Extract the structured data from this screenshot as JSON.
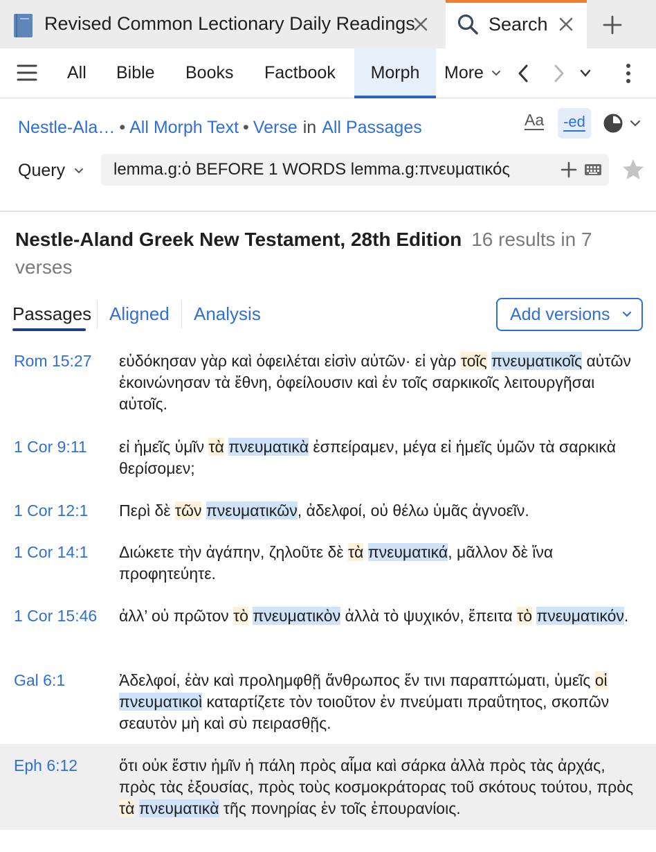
{
  "window_tabs": {
    "document_tab_title": "Revised Common Lectionary Daily Readings",
    "search_tab_title": "Search"
  },
  "toolbar": {
    "categories": [
      "All",
      "Bible",
      "Books",
      "Factbook",
      "Morph"
    ],
    "active_category": "Morph",
    "more_label": "More"
  },
  "query_area": {
    "crumbs": {
      "resource": "Nestle-Ala…",
      "scope": "All Morph Text",
      "unit": "Verse",
      "in_word": "in",
      "range": "All Passages"
    },
    "aa_label": "Aa",
    "ed_label": "-ed",
    "query_label": "Query",
    "query_text": "lemma.g:ὁ BEFORE 1 WORDS lemma.g:πνευματικός"
  },
  "results": {
    "resource_title": "Nestle-Aland Greek New Testament, 28th Edition",
    "count_text": "16 results in 7 verses",
    "tabs": [
      "Passages",
      "Aligned",
      "Analysis"
    ],
    "active_tab": "Passages",
    "add_versions_label": "Add versions",
    "items": [
      {
        "ref": "Rom 15:27",
        "segments": [
          {
            "t": "εὐδόκησαν γὰρ καὶ ὀφειλέται εἰσὶν αὐτῶν· εἰ γὰρ ",
            "h": ""
          },
          {
            "t": "τοῖς",
            "h": "y"
          },
          {
            "t": " ",
            "h": ""
          },
          {
            "t": "πνευματικοῖς",
            "h": "b"
          },
          {
            "t": " αὐτῶν ἐκοινώνησαν τὰ ἔθνη, ὀφείλουσιν καὶ ἐν τοῖς σαρκικοῖς λειτουργῆσαι αὐτοῖς.",
            "h": ""
          }
        ]
      },
      {
        "ref": "1 Cor 9:11",
        "segments": [
          {
            "t": "εἰ ἡμεῖς ὑμῖν ",
            "h": ""
          },
          {
            "t": "τὰ",
            "h": "y"
          },
          {
            "t": " ",
            "h": ""
          },
          {
            "t": "πνευματικὰ",
            "h": "b"
          },
          {
            "t": " ἐσπείραμεν, μέγα εἰ ἡμεῖς ὑμῶν τὰ σαρκικὰ θερίσομεν;",
            "h": ""
          }
        ]
      },
      {
        "ref": "1 Cor 12:1",
        "segments": [
          {
            "t": "Περὶ δὲ ",
            "h": ""
          },
          {
            "t": "τῶν",
            "h": "y"
          },
          {
            "t": " ",
            "h": ""
          },
          {
            "t": "πνευματικῶν",
            "h": "b"
          },
          {
            "t": ", ἀδελφοί, οὐ θέλω ὑμᾶς ἀγνοεῖν.",
            "h": ""
          }
        ]
      },
      {
        "ref": "1 Cor 14:1",
        "segments": [
          {
            "t": "Διώκετε τὴν ἀγάπην, ζηλοῦτε δὲ ",
            "h": ""
          },
          {
            "t": "τὰ",
            "h": "y"
          },
          {
            "t": " ",
            "h": ""
          },
          {
            "t": "πνευματικά",
            "h": "b"
          },
          {
            "t": ", μᾶλλον δὲ ἵνα προφητεύητε.",
            "h": ""
          }
        ]
      },
      {
        "ref": "1 Cor 15:46",
        "segments": [
          {
            "t": "ἀλλ’ οὐ πρῶτον ",
            "h": ""
          },
          {
            "t": "τὸ",
            "h": "y"
          },
          {
            "t": " ",
            "h": ""
          },
          {
            "t": "πνευματικὸν",
            "h": "b"
          },
          {
            "t": " ἀλλὰ τὸ ψυχικόν, ἔπειτα ",
            "h": ""
          },
          {
            "t": "τὸ",
            "h": "y"
          },
          {
            "t": " ",
            "h": ""
          },
          {
            "t": "πνευματικόν",
            "h": "b"
          },
          {
            "t": ".",
            "h": ""
          }
        ]
      },
      {
        "ref": "Gal 6:1",
        "segments": [
          {
            "t": "Ἀδελφοί, ἐὰν καὶ προλημφθῇ ἄνθρωπος ἔν τινι παραπτώματι, ὑμεῖς ",
            "h": ""
          },
          {
            "t": "οἱ",
            "h": "y"
          },
          {
            "t": " ",
            "h": ""
          },
          {
            "t": "πνευματικοὶ",
            "h": "b"
          },
          {
            "t": " καταρτίζετε τὸν τοιοῦτον ἐν πνεύματι πραΰτητος, σκοπῶν σεαυτὸν μὴ καὶ σὺ πειρασθῇς.",
            "h": ""
          }
        ]
      },
      {
        "ref": "Eph 6:12",
        "segments": [
          {
            "t": "ὅτι οὐκ ἔστιν ἡμῖν ἡ πάλη πρὸς αἷμα καὶ σάρκα ἀλλὰ πρὸς τὰς ἀρχάς, πρὸς τὰς ἐξουσίας, πρὸς τοὺς κοσμοκράτορας τοῦ σκότους τούτου, πρὸς ",
            "h": ""
          },
          {
            "t": "τὰ",
            "h": "y"
          },
          {
            "t": " ",
            "h": ""
          },
          {
            "t": "πνευματικὰ",
            "h": "b"
          },
          {
            "t": " τῆς πονηρίας ἐν τοῖς ἐπουρανίοις.",
            "h": ""
          }
        ]
      }
    ]
  },
  "colors": {
    "accent": "#2e6fd8",
    "active_tab_indicator": "#f07c30",
    "article_highlight": "#fdf1d9",
    "lemma_highlight": "#cfe2f8"
  },
  "icons": [
    "book-icon",
    "close-icon",
    "magnifier-icon",
    "plus-icon",
    "hamburger-menu-icon",
    "chevron-left-icon",
    "chevron-right-icon",
    "chevron-down-icon",
    "kebab-menu-icon",
    "contrast-icon",
    "keyboard-icon",
    "star-icon"
  ]
}
